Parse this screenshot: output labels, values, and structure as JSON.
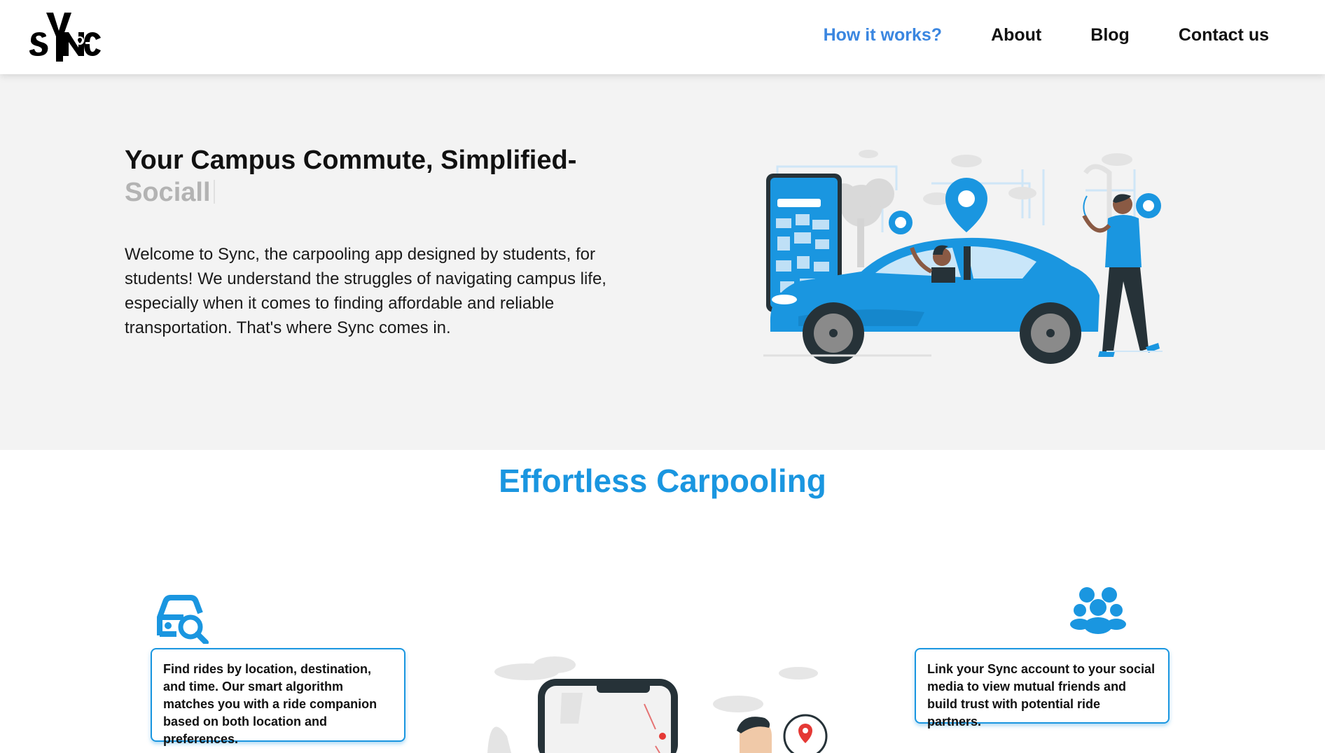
{
  "nav": {
    "links": [
      {
        "label": "How it works?",
        "active": true
      },
      {
        "label": "About",
        "active": false
      },
      {
        "label": "Blog",
        "active": false
      },
      {
        "label": "Contact us",
        "active": false
      }
    ]
  },
  "hero": {
    "title": "Your Campus Commute, Simplified-",
    "typed_word": "Sociall",
    "description": "Welcome to Sync, the carpooling app designed by students, for students! We understand the struggles of navigating campus life, especially when it comes to finding affordable and reliable transportation. That's where Sync comes in."
  },
  "section": {
    "title": "Effortless Carpooling",
    "features": [
      {
        "icon": "car-search-icon",
        "text": "Find rides by location, destination, and time. Our smart algorithm matches you with a ride companion based on both location and preferences."
      },
      {
        "icon": "users-group-icon",
        "text": "Link your Sync account to your social media to view mutual friends and build trust with potential ride partners."
      }
    ]
  },
  "colors": {
    "accent": "#1a96e0",
    "nav_active": "#3a86e0",
    "hero_bg": "#f3f3f3"
  }
}
